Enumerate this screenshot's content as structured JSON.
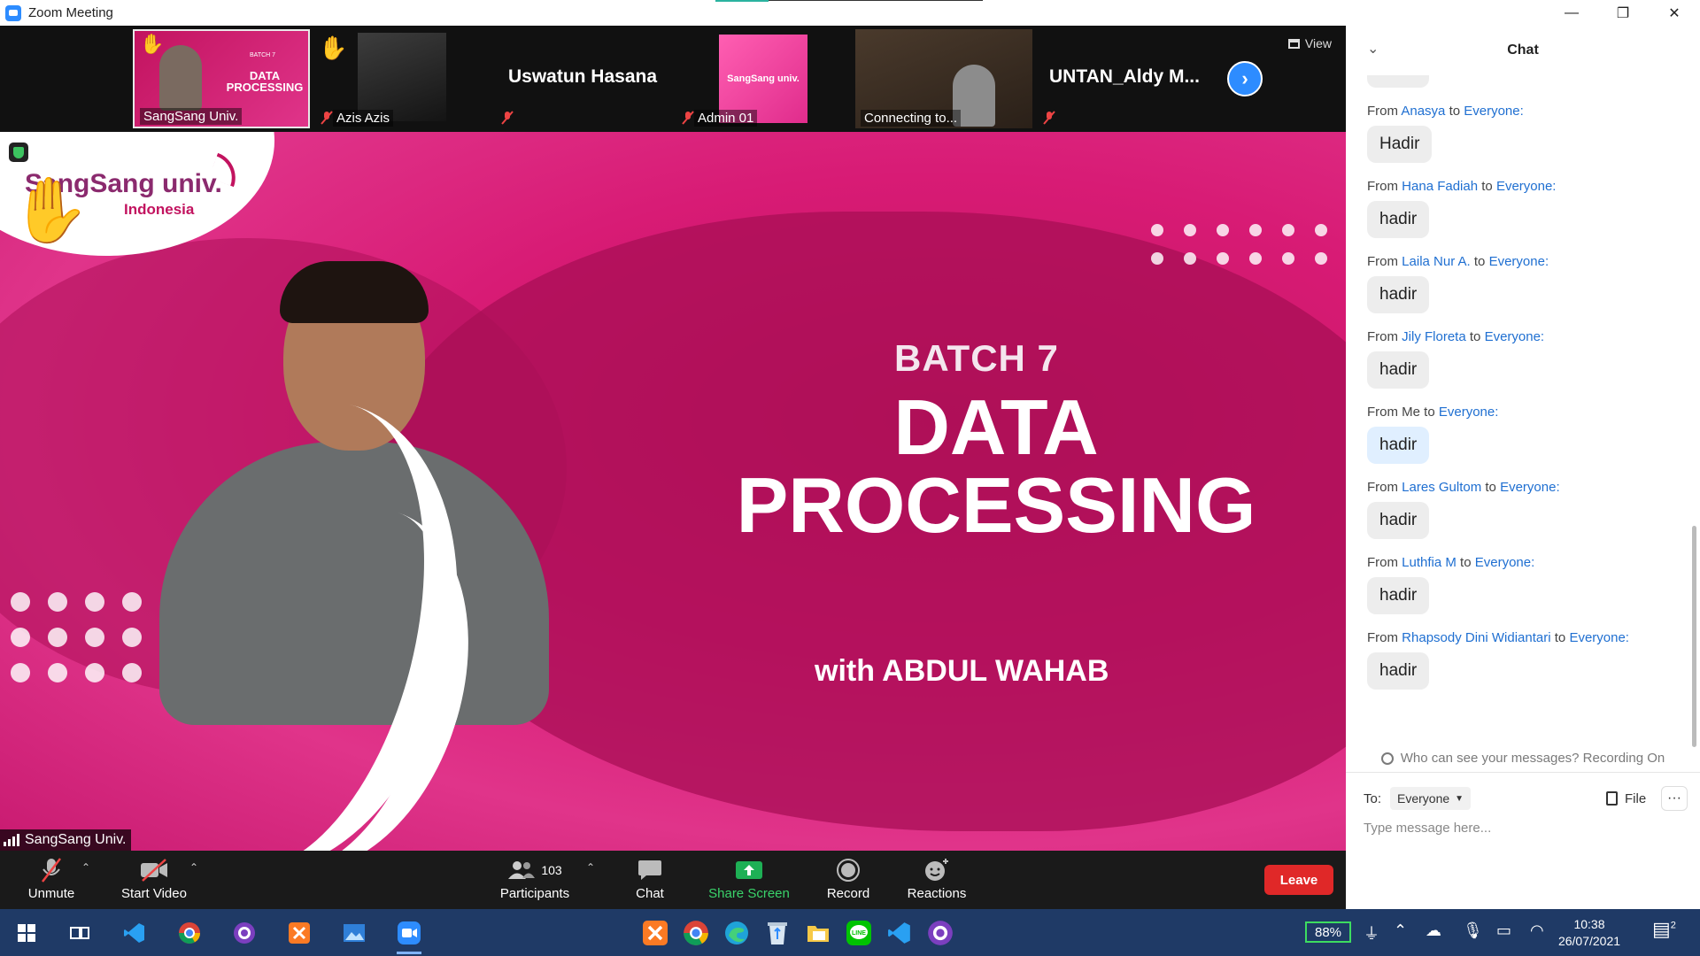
{
  "window": {
    "title": "Zoom Meeting",
    "minimize": "—",
    "restore": "❐",
    "close": "✕"
  },
  "strip": {
    "thumbs": [
      {
        "name": "SangSang Univ.",
        "kind": "slide",
        "mini_title": "DATA PROCESSING",
        "mini_batch": "BATCH 7"
      },
      {
        "name": "Azis Azis",
        "kind": "photo"
      },
      {
        "name": "Uswatun Hasana",
        "kind": "name-only"
      },
      {
        "name": "Admin 01",
        "kind": "logo",
        "mini_logo": "SangSang univ."
      },
      {
        "name": "Connecting to...",
        "kind": "video"
      },
      {
        "name": "UNTAN_Aldy M...",
        "kind": "name-only"
      }
    ],
    "view_label": "View",
    "next_icon": "›"
  },
  "slide": {
    "logo_text": "SangSang univ.",
    "logo_sub": "Indonesia",
    "batch": "BATCH 7",
    "headline_1": "DATA",
    "headline_2": "PROCESSING",
    "with": "with ABDUL WAHAB",
    "speaker_label": "SangSang Univ."
  },
  "toolbar": {
    "unmute": "Unmute",
    "start_video": "Start Video",
    "participants": "Participants",
    "participants_count": "103",
    "chat": "Chat",
    "share_screen": "Share Screen",
    "record": "Record",
    "reactions": "Reactions",
    "leave": "Leave"
  },
  "chat": {
    "title": "Chat",
    "messages": [
      {
        "from_prefix": "From",
        "sender": "Anasya",
        "to": "to",
        "recipient": "Everyone:",
        "text": "Hadir"
      },
      {
        "from_prefix": "From",
        "sender": "Hana Fadiah",
        "to": "to",
        "recipient": "Everyone:",
        "text": "hadir"
      },
      {
        "from_prefix": "From",
        "sender": "Laila Nur A.",
        "to": "to",
        "recipient": "Everyone:",
        "text": "hadir"
      },
      {
        "from_prefix": "From",
        "sender": "Jily Floreta",
        "to": "to",
        "recipient": "Everyone:",
        "text": "hadir"
      },
      {
        "from_prefix": "From Me",
        "sender": "",
        "to": "to",
        "recipient": "Everyone:",
        "text": "hadir",
        "me": true
      },
      {
        "from_prefix": "From",
        "sender": "Lares Gultom",
        "to": "to",
        "recipient": "Everyone:",
        "text": "hadir"
      },
      {
        "from_prefix": "From",
        "sender": "Luthfia M",
        "to": "to",
        "recipient": "Everyone:",
        "text": "hadir"
      },
      {
        "from_prefix": "From",
        "sender": "Rhapsody Dini Widiantari",
        "to": "to",
        "recipient": "Everyone:",
        "text": "hadir"
      }
    ],
    "notice": "Who can see your messages? Recording On",
    "to_label": "To:",
    "to_value": "Everyone",
    "file_label": "File",
    "more": "···",
    "placeholder": "Type message here..."
  },
  "taskbar": {
    "battery": "88%",
    "time": "10:38",
    "date": "26/07/2021",
    "notif_count": "2"
  },
  "colors": {
    "zoom_blue": "#2d8cff",
    "leave_red": "#e02828",
    "slide_magenta": "#d81b75",
    "link_blue": "#1f6fd1",
    "taskbar": "#1f3a66"
  }
}
